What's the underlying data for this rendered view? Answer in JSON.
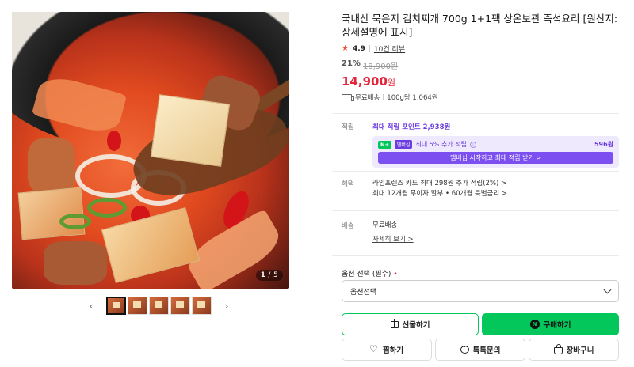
{
  "gallery": {
    "counter_current": "1",
    "counter_total": "/ 5",
    "prev_icon": "chevron-left-icon",
    "next_icon": "chevron-right-icon",
    "thumbnail_count": 5,
    "active_index": 0
  },
  "product": {
    "title": "국내산 묵은지 김치찌개 700g 1+1팩 상온보관 즉석요리 [원산지: 상세설명에 표시]",
    "rating": "4.9",
    "reviews": "10건 리뷰",
    "discount_pct": "21%",
    "original_price": "18,900원",
    "price": "14,900",
    "price_unit": "원",
    "shipping": "무료배송",
    "unit_price": "100g당 1,064원"
  },
  "benefits": {
    "points_label": "적립",
    "points_link": "최대 적립 포인트 2,938원",
    "npay_badge": "N+",
    "membership_badge": "멤버십",
    "npay_text": "최대 5% 추가 적립",
    "npay_amount": "596원",
    "npay_button": "멤버십 시작하고 최대 적립 받기 >",
    "perk_label": "혜택",
    "perk_line1": "라인프렌즈 카드 최대 298원 추가 적립(2%) >",
    "perk_line2": "최대 12개월 무이자 할부 • 60개월 특별금리 >",
    "delivery_label": "배송",
    "delivery_value": "무료배송",
    "delivery_link": "자세히 보기 >"
  },
  "options": {
    "label": "옵션 선택 (필수)",
    "required_mark": "•",
    "select_value": "옵션선택"
  },
  "actions": {
    "gift": "선물하기",
    "buy": "구매하기",
    "buy_logo": "N",
    "wish": "찜하기",
    "talk": "톡톡문의",
    "cart": "장바구니"
  },
  "colors": {
    "price": "#e2253a",
    "npay_green": "#03c75a",
    "membership_purple": "#6b3ce0"
  }
}
